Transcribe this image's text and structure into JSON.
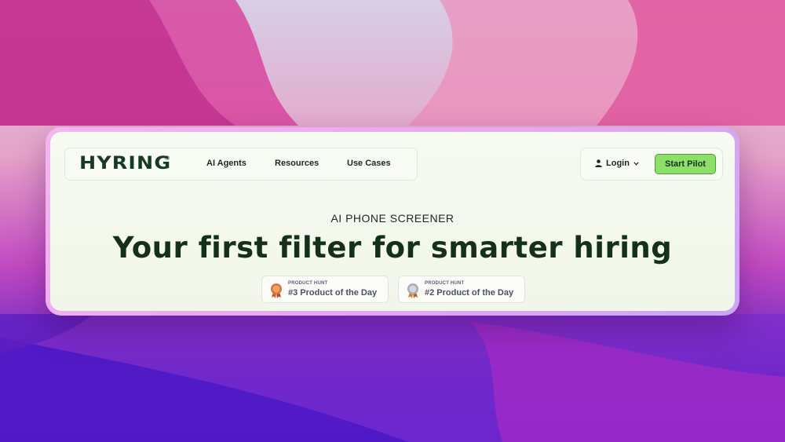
{
  "nav": {
    "logo": "HYRING",
    "logo_mark": "®",
    "links": [
      "AI Agents",
      "Resources",
      "Use Cases"
    ],
    "login_label": "Login",
    "cta_label": "Start Pilot"
  },
  "hero": {
    "eyebrow": "AI PHONE SCREENER",
    "headline": "Your first filter for smarter hiring"
  },
  "badges": [
    {
      "kicker": "PRODUCT HUNT",
      "title": "#3 Product of the Day",
      "medal": "bronze-medal-icon"
    },
    {
      "kicker": "PRODUCT HUNT",
      "title": "#2 Product of the Day",
      "medal": "silver-medal-icon"
    }
  ],
  "colors": {
    "accent_green": "#8ce06a",
    "brand_dark_green": "#163a22",
    "frame_pink": "#f3b6ef"
  }
}
